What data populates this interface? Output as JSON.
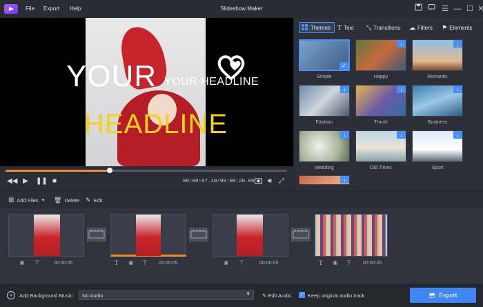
{
  "window": {
    "title": "Slideshow Maker"
  },
  "menu": {
    "file": "File",
    "export": "Export",
    "help": "Help"
  },
  "preview": {
    "headline_large_1": "YOUR",
    "headline_large_2": "HEADLINE",
    "headline_small": "YOUR HEADLINE",
    "timecode": "00:00:07.10/00:00:20.00",
    "progress_fraction": 0.37
  },
  "tabs": {
    "themes": "Themes",
    "text": "Text",
    "transitions": "Transitions",
    "filters": "Filters",
    "elements": "Elements"
  },
  "themes": [
    {
      "label": "Simple"
    },
    {
      "label": "Happy"
    },
    {
      "label": "Romantic"
    },
    {
      "label": "Fashion"
    },
    {
      "label": "Travel"
    },
    {
      "label": "Business"
    },
    {
      "label": "Wedding"
    },
    {
      "label": "Old Times"
    },
    {
      "label": "Sport"
    }
  ],
  "toolbar": {
    "add_files": "Add Files",
    "delete": "Delete",
    "edit": "Edit"
  },
  "clips": [
    {
      "duration": "00:00:05"
    },
    {
      "duration": "00:00:05"
    },
    {
      "duration": "00:00:05"
    },
    {
      "duration": "00:00:05"
    }
  ],
  "bottom": {
    "add_music_label": "Add Background Music:",
    "audio_value": "No Audio",
    "edit_audio": "Edit Audio",
    "keep_audio": "Keep original audio track",
    "export": "Export"
  },
  "colors": {
    "accent": "#4a8ff5",
    "progress": "#f08a2b",
    "headline_yellow": "#f4d11d"
  }
}
